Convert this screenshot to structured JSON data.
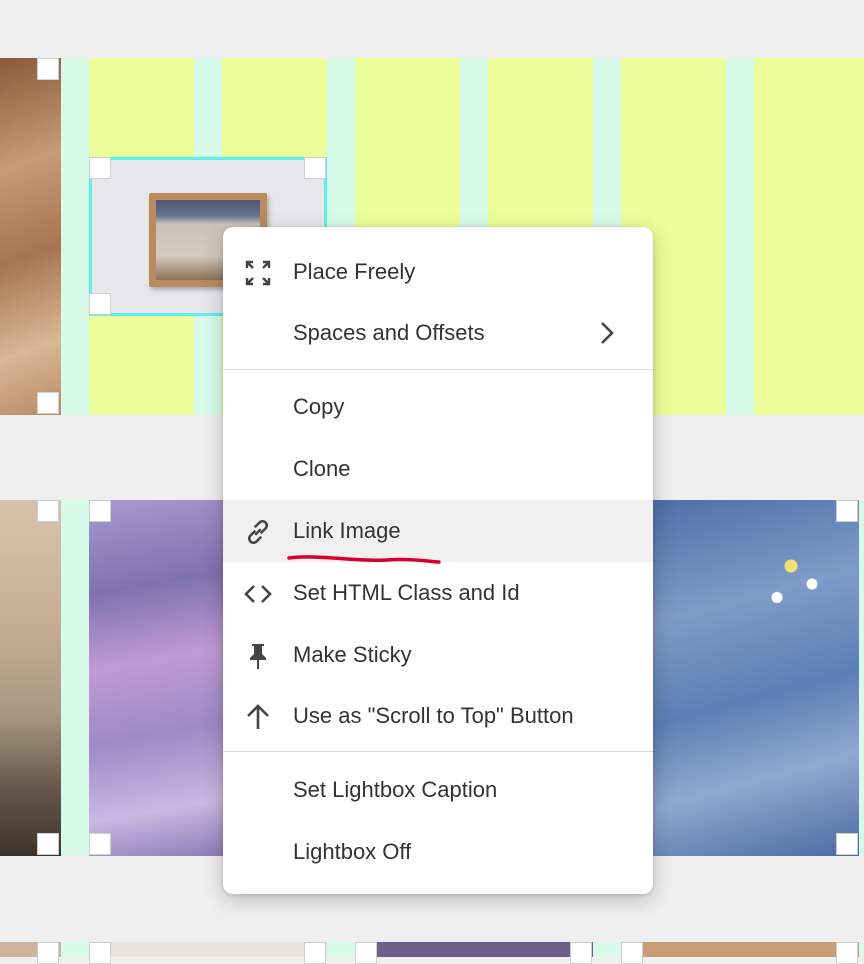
{
  "menu": {
    "items": [
      {
        "label": "Place Freely",
        "icon": "expand-arrows-icon"
      },
      {
        "label": "Spaces and Offsets",
        "icon": "none",
        "submenu": true
      },
      {
        "label": "Copy",
        "icon": "none"
      },
      {
        "label": "Clone",
        "icon": "none"
      },
      {
        "label": "Link Image",
        "icon": "link-icon",
        "highlighted": true
      },
      {
        "label": "Set HTML Class and Id",
        "icon": "code-icon"
      },
      {
        "label": "Make Sticky",
        "icon": "pin-icon"
      },
      {
        "label": "Use as \"Scroll to Top\" Button",
        "icon": "arrow-up-icon"
      },
      {
        "label": "Set Lightbox Caption",
        "icon": "none"
      },
      {
        "label": "Lightbox Off",
        "icon": "none"
      }
    ]
  },
  "colors": {
    "canvas": "#efefef",
    "grid_column": "#ecfe99",
    "grid_gutter": "#d8fbe9",
    "selection": "#5ef0ef",
    "annotation": "#d8002a"
  }
}
